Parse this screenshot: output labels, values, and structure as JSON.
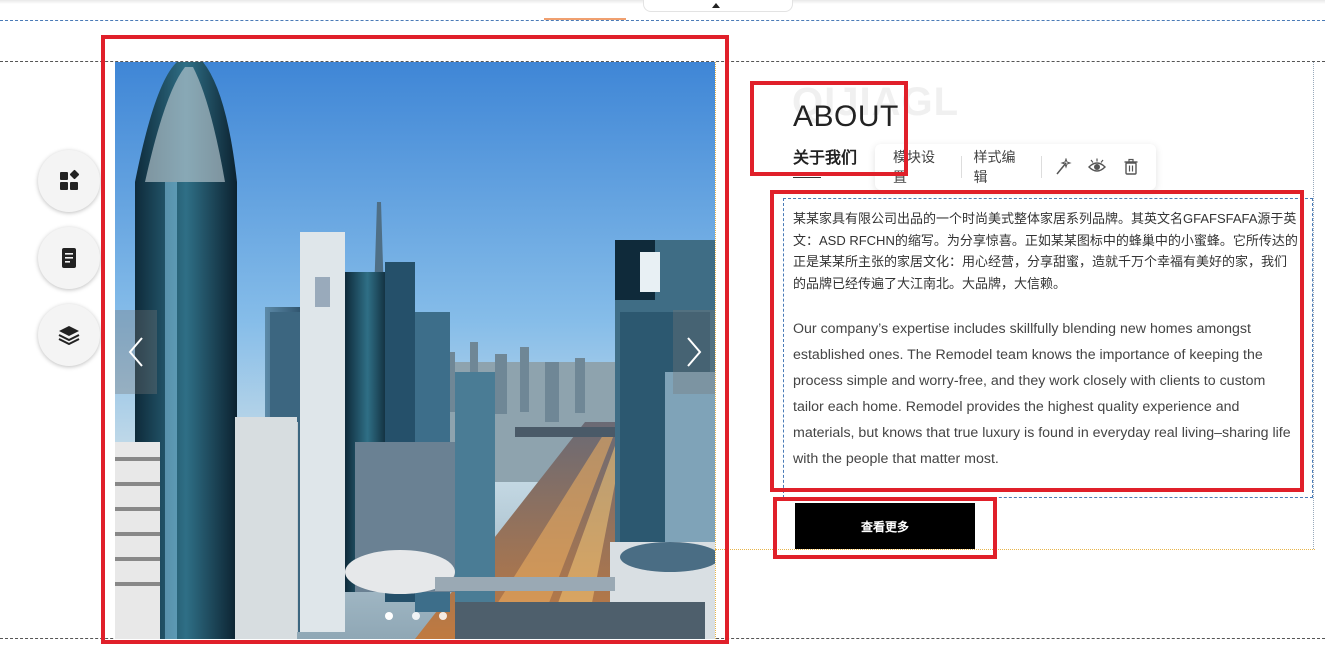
{
  "toolbar_top": {
    "tab_icon": "caret-up-icon"
  },
  "left_tools": [
    {
      "name": "widgets",
      "icon": "widgets-icon"
    },
    {
      "name": "page",
      "icon": "document-icon"
    },
    {
      "name": "layers",
      "icon": "layers-icon"
    }
  ],
  "carousel": {
    "prev_icon": "chevron-left-icon",
    "next_icon": "chevron-right-icon",
    "slide_count": 3,
    "active_index": 0,
    "image": "city-skyline-dusk"
  },
  "about": {
    "watermark": "QIJIAGL",
    "title": "ABOUT",
    "subtitle": "关于我们",
    "paragraph_cn": "某某家具有限公司出品的一个时尚美式整体家居系列品牌。其英文名GFAFSFAFA源于英文：ASD RFCHN的缩写。为分享惊喜。正如某某图标中的蜂巢中的小蜜蜂。它所传达的正是某某所主张的家居文化：用心经营，分享甜蜜，造就千万个幸福有美好的家，我们的品牌已经传遍了大江南北。大品牌，大信赖。",
    "paragraph_en": "Our company’s expertise includes skillfully blending new homes amongst established ones. The Remodel team knows the importance of keeping the process simple and worry-free, and they work closely with clients to custom tailor each home. Remodel provides the highest quality experience and materials, but knows that true luxury is found in everyday real living–sharing life with the people that matter most.",
    "button_label": "查看更多"
  },
  "module_toolbar": {
    "module_settings": "模块设置",
    "style_edit": "样式编辑",
    "icons": [
      "magic-wand-icon",
      "eye-icon",
      "trash-icon"
    ]
  },
  "colors": {
    "annotation_red": "#e0202a",
    "button_bg": "#000000",
    "guide_blue": "#4a7bb7",
    "guide_orange": "#e8b54a"
  }
}
